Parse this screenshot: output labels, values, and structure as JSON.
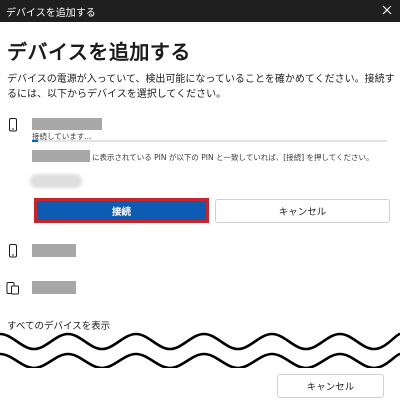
{
  "window": {
    "title": "デバイスを追加する"
  },
  "header": {
    "heading": "デバイスを追加する",
    "description": "デバイスの電源が入っていて、検出可能になっていることを確かめてください。接続するには、以下からデバイスを選択してください。"
  },
  "selected_device": {
    "icon": "phone-icon",
    "status": "接続しています...",
    "pin_instruction": "に表示されている PIN が以下の PIN と一致していれば、[接続] を押してください。"
  },
  "buttons": {
    "connect": "接続",
    "cancel": "キャンセル"
  },
  "devices": [
    {
      "icon": "phone-icon"
    },
    {
      "icon": "phone-icon"
    },
    {
      "icon": "devices-icon"
    }
  ],
  "links": {
    "show_all": "すべてのデバイスを表示"
  },
  "footer": {
    "cancel": "キャンセル"
  },
  "colors": {
    "titlebar": "#1f1f1f",
    "accent": "#0e5bb3",
    "highlight_border": "#c5262c",
    "redaction": "#a7a7a7"
  }
}
